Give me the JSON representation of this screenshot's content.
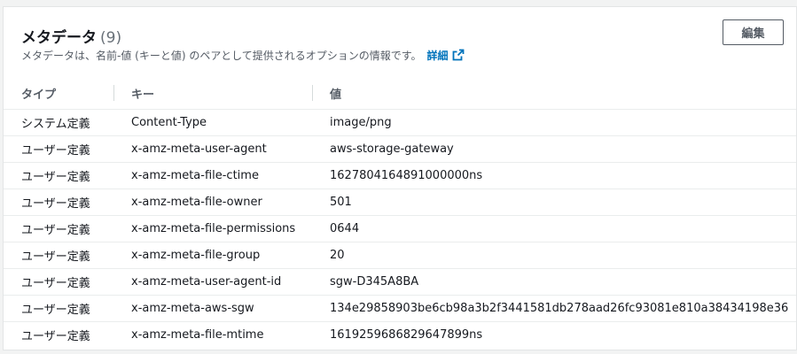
{
  "metadata": {
    "title": "メタデータ",
    "count": "(9)",
    "description": "メタデータは、名前-値 (キーと値) のペアとして提供されるオプションの情報です。",
    "detail_link": "詳細",
    "edit_label": "編集",
    "columns": {
      "type": "タイプ",
      "key": "キー",
      "value": "値"
    },
    "rows": [
      {
        "type": "システム定義",
        "key": "Content-Type",
        "value": "image/png"
      },
      {
        "type": "ユーザー定義",
        "key": "x-amz-meta-user-agent",
        "value": "aws-storage-gateway"
      },
      {
        "type": "ユーザー定義",
        "key": "x-amz-meta-file-ctime",
        "value": "1627804164891000000ns"
      },
      {
        "type": "ユーザー定義",
        "key": "x-amz-meta-file-owner",
        "value": "501"
      },
      {
        "type": "ユーザー定義",
        "key": "x-amz-meta-file-permissions",
        "value": "0644"
      },
      {
        "type": "ユーザー定義",
        "key": "x-amz-meta-file-group",
        "value": "20"
      },
      {
        "type": "ユーザー定義",
        "key": "x-amz-meta-user-agent-id",
        "value": "sgw-D345A8BA"
      },
      {
        "type": "ユーザー定義",
        "key": "x-amz-meta-aws-sgw",
        "value": "134e29858903be6cb98a3b2f3441581db278aad26fc93081e810a38434198e36"
      },
      {
        "type": "ユーザー定義",
        "key": "x-amz-meta-file-mtime",
        "value": "1619259686829647899ns"
      }
    ]
  },
  "colors": {
    "link": "#0073bb",
    "text": "#16191f",
    "muted": "#545b64"
  },
  "icons": {
    "detail_link": "external-link-icon"
  }
}
